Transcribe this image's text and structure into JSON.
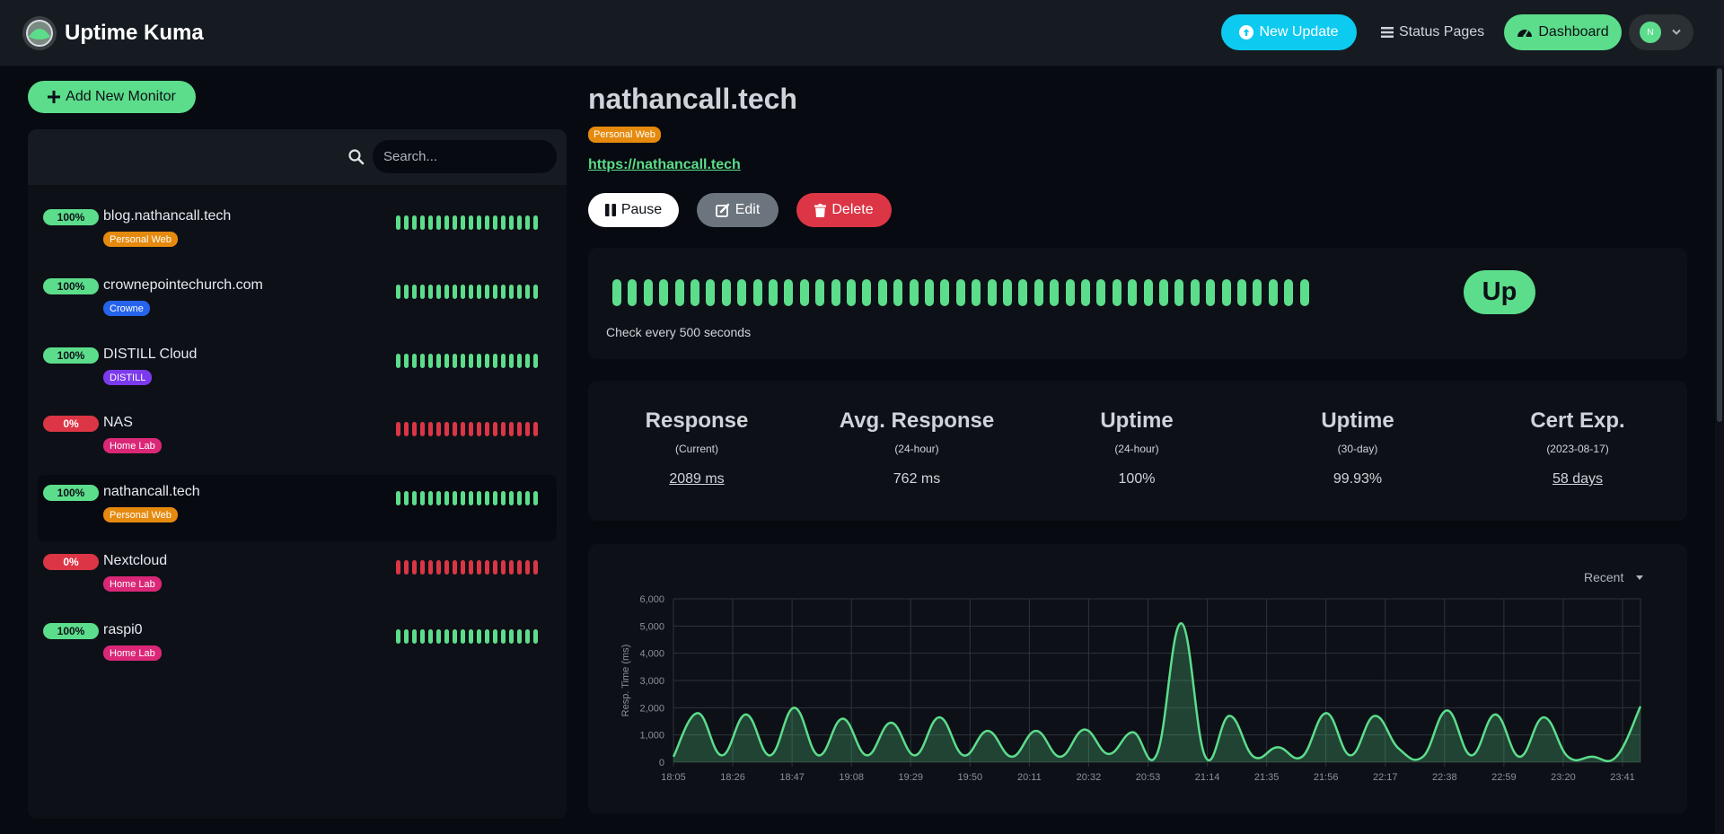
{
  "header": {
    "app_title": "Uptime Kuma",
    "new_update_label": "New Update",
    "status_pages_label": "Status Pages",
    "dashboard_label": "Dashboard",
    "avatar_initial": "N"
  },
  "sidebar": {
    "add_monitor_label": "Add New Monitor",
    "search_placeholder": "Search...",
    "monitors": [
      {
        "name": "blog.nathancall.tech",
        "uptime": "100%",
        "status": "up",
        "tag": "Personal Web",
        "tag_color": "#e58a0e",
        "active": false
      },
      {
        "name": "crownepointechurch.com",
        "uptime": "100%",
        "status": "up",
        "tag": "Crowne",
        "tag_color": "#2563eb",
        "active": false
      },
      {
        "name": "DISTILL Cloud",
        "uptime": "100%",
        "status": "up",
        "tag": "DISTILL",
        "tag_color": "#7c3aed",
        "active": false
      },
      {
        "name": "NAS",
        "uptime": "0%",
        "status": "down",
        "tag": "Home Lab",
        "tag_color": "#db2777",
        "active": false
      },
      {
        "name": "nathancall.tech",
        "uptime": "100%",
        "status": "up",
        "tag": "Personal Web",
        "tag_color": "#e58a0e",
        "active": true
      },
      {
        "name": "Nextcloud",
        "uptime": "0%",
        "status": "down",
        "tag": "Home Lab",
        "tag_color": "#db2777",
        "active": false
      },
      {
        "name": "raspi0",
        "uptime": "100%",
        "status": "up",
        "tag": "Home Lab",
        "tag_color": "#db2777",
        "active": false
      }
    ]
  },
  "detail": {
    "title": "nathancall.tech",
    "tag": "Personal Web",
    "url": "https://nathancall.tech",
    "pause_label": "Pause",
    "edit_label": "Edit",
    "delete_label": "Delete",
    "check_every": "Check every 500 seconds",
    "status": "Up",
    "stats": [
      {
        "title": "Response",
        "sub": "(Current)",
        "value": "2089 ms",
        "link": true
      },
      {
        "title": "Avg. Response",
        "sub": "(24-hour)",
        "value": "762 ms",
        "link": false
      },
      {
        "title": "Uptime",
        "sub": "(24-hour)",
        "value": "100%",
        "link": false
      },
      {
        "title": "Uptime",
        "sub": "(30-day)",
        "value": "99.93%",
        "link": false
      },
      {
        "title": "Cert Exp.",
        "sub": "(2023-08-17)",
        "value": "58 days",
        "link": true
      }
    ],
    "range_label": "Recent"
  },
  "colors": {
    "up": "#5cdd8b",
    "down": "#dc3545",
    "accent": "#0dcaf0"
  },
  "chart_data": {
    "type": "area",
    "title": "",
    "xlabel": "",
    "ylabel": "Resp. Time (ms)",
    "ylim": [
      0,
      6000
    ],
    "yticks": [
      "0",
      "1,000",
      "2,000",
      "3,000",
      "4,000",
      "5,000",
      "6,000"
    ],
    "xticks": [
      "18:05",
      "18:26",
      "18:47",
      "19:08",
      "19:29",
      "19:50",
      "20:11",
      "20:32",
      "20:53",
      "21:14",
      "21:35",
      "21:56",
      "22:17",
      "22:38",
      "22:59",
      "23:20",
      "23:41"
    ],
    "series": [
      {
        "values": [
          200,
          1800,
          250,
          1750,
          250,
          2000,
          250,
          1600,
          250,
          1450,
          250,
          1650,
          250,
          1150,
          200,
          1150,
          200,
          1200,
          300,
          1100,
          300,
          5100,
          200,
          1700,
          200,
          550,
          200,
          1800,
          250,
          1700,
          500,
          200,
          1900,
          250,
          1750,
          200,
          1650,
          200,
          200,
          200,
          2050
        ]
      }
    ]
  }
}
